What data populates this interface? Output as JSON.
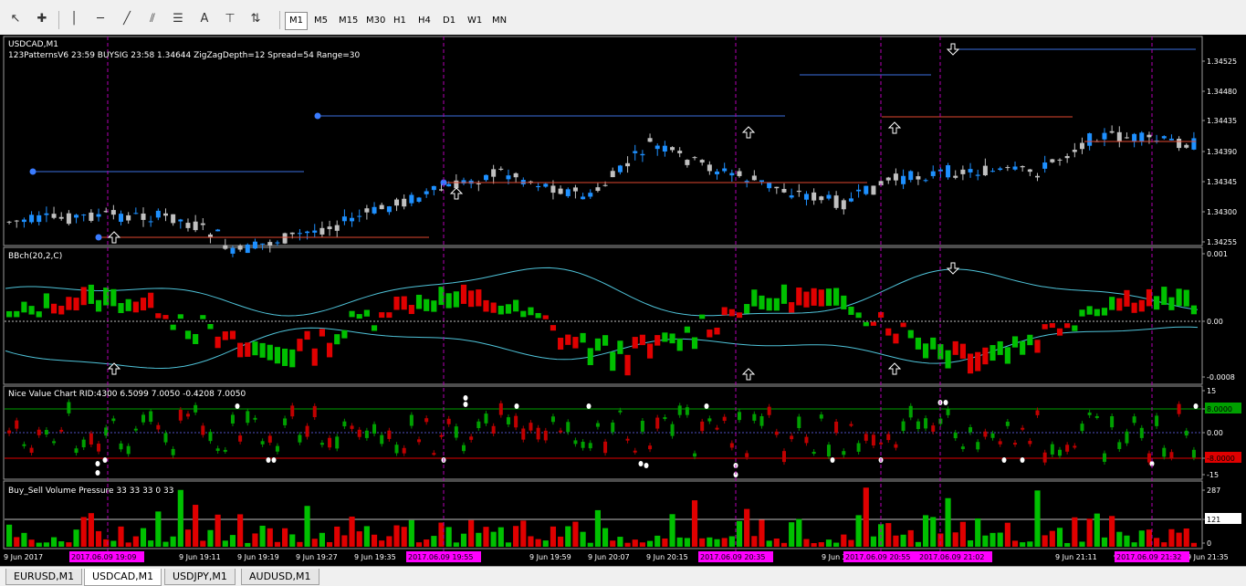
{
  "toolbar": {
    "icons": [
      "cursor-icon",
      "crosshair-icon",
      "vertical-line-icon",
      "horizontal-line-icon",
      "trendline-icon",
      "equidistant-channel-icon",
      "fibonacci-icon",
      "text-icon",
      "text-label-icon",
      "arrows-icon"
    ],
    "timeframes": [
      "M1",
      "M5",
      "M15",
      "M30",
      "H1",
      "H4",
      "D1",
      "W1",
      "MN"
    ],
    "active_timeframe": "M1"
  },
  "main_panel": {
    "title": "USDCAD,M1",
    "indicator_line": "123PatternsV6 23:59  BUYSIG  23:58  1.34644  ZigZagDepth=12  Spread=54  Range=30",
    "price_labels": [
      "1.34525",
      "1.34480",
      "1.34435",
      "1.34390",
      "1.34345",
      "1.34300",
      "1.34255"
    ]
  },
  "bb_panel": {
    "title": "BBch(20,2,C)",
    "scale_labels": [
      "0.001",
      "0.00",
      "-0.0008"
    ]
  },
  "nvc_panel": {
    "title": "Nice Value Chart RID:4300 6.5099 7.0050 -0.4208 7.0050",
    "scale_labels": [
      "15",
      "8.0000",
      "0.00",
      "-8.0000",
      "-15"
    ]
  },
  "volume_panel": {
    "title": "Buy_Sell Volume Pressure 33 33 33 0 33",
    "scale_labels": [
      "287",
      "121",
      "0"
    ]
  },
  "time_axis": {
    "labels": [
      "9 Jun 2017",
      "9 Jun 19:11",
      "9 Jun 19:19",
      "9 Jun 19:27",
      "9 Jun 19:35",
      "9 Jun 19:43",
      "9 Jun 19:59",
      "9 Jun 20:07",
      "9 Jun 20:15",
      "9 Jun 20:23",
      "9 Jun 20:39",
      "9 Jun 21:11",
      "9 Jun 21:19",
      "9 Jun 21:35"
    ],
    "highlight_labels": [
      "2017.06.09 19:09",
      "2017.06.09 19:55",
      "2017.06.09 20:35",
      "2017.06.09 20:55",
      "2017.06.09 21:02",
      "2017.06.09 21:32"
    ]
  },
  "tabs": [
    "EURUSD,M1",
    "USDCAD,M1",
    "USDJPY,M1",
    "AUDUSD,M1"
  ],
  "active_tab": "USDCAD,M1",
  "colors": {
    "background": "#000000",
    "bull_candle": "#1e90ff",
    "bear_candle": "#c0c0c0",
    "resistance_line": "#3b6fe0",
    "support_line": "#e0482f",
    "bb_band": "#4fc3d9",
    "bull_bar": "#00c000",
    "bear_bar": "#e00000",
    "marker_line": "#b400b4",
    "highlight_label_bg": "#ff00ff",
    "nvc_upper": "#00a000",
    "nvc_lower": "#e00000"
  }
}
